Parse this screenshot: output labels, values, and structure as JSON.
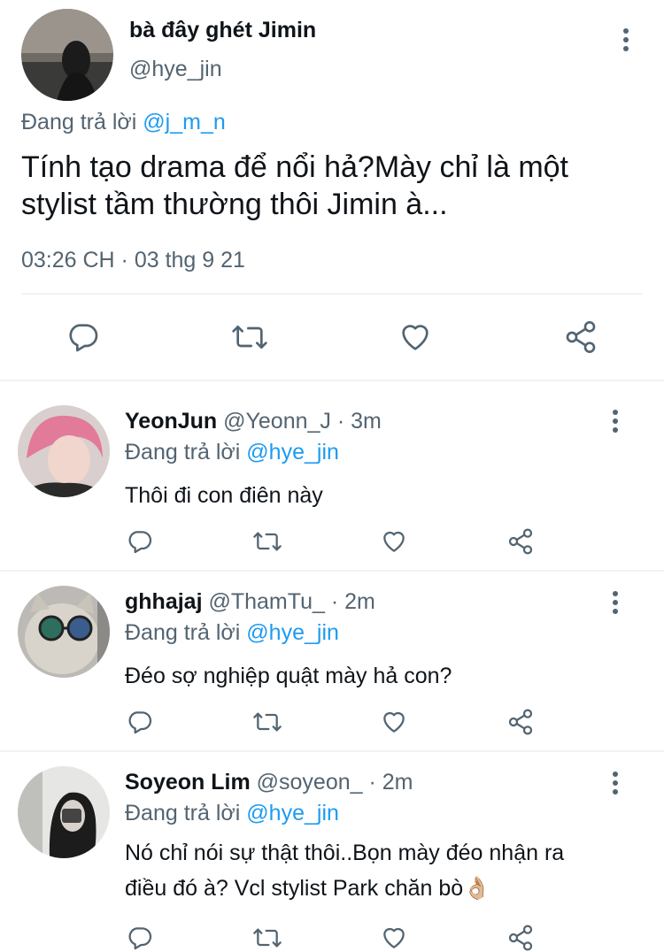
{
  "main_tweet": {
    "display_name": "bà đây ghét Jimin",
    "handle": "@hye_jin",
    "reply_prefix": "Đang trả lời",
    "reply_to": "@j_m_n",
    "text_line1": "Tính tạo drama để nổi hả?Mày chỉ là một",
    "text_line2": "stylist tầm thường thôi Jimin à...",
    "timestamp": "03:26 CH · 03 thg 9 21"
  },
  "replies": [
    {
      "display_name": "YeonJun",
      "meta": "@Yeonn_J · 3m",
      "reply_prefix": "Đang trả lời",
      "reply_to": "@hye_jin",
      "text_line1": "Thôi đi con điên này",
      "text_line2": ""
    },
    {
      "display_name": "ghhajaj",
      "meta": "@ThamTu_ · 2m",
      "reply_prefix": "Đang trả lời",
      "reply_to": "@hye_jin",
      "text_line1": "Đéo sợ nghiệp quật mày hả con?",
      "text_line2": ""
    },
    {
      "display_name": "Soyeon Lim",
      "meta": "@soyeon_ · 2m",
      "reply_prefix": "Đang trả lời",
      "reply_to": "@hye_jin",
      "text_line1": "Nó chỉ nói sự thật thôi..Bọn mày đéo nhận ra",
      "text_line2": "điều đó à? Vcl stylist Park chăn bò👌🏼"
    }
  ],
  "icons": [
    "reply-icon",
    "retweet-icon",
    "like-icon",
    "share-icon",
    "more-icon"
  ],
  "colors": {
    "link": "#1d9bf0",
    "muted": "#536471",
    "text": "#0f1419"
  }
}
